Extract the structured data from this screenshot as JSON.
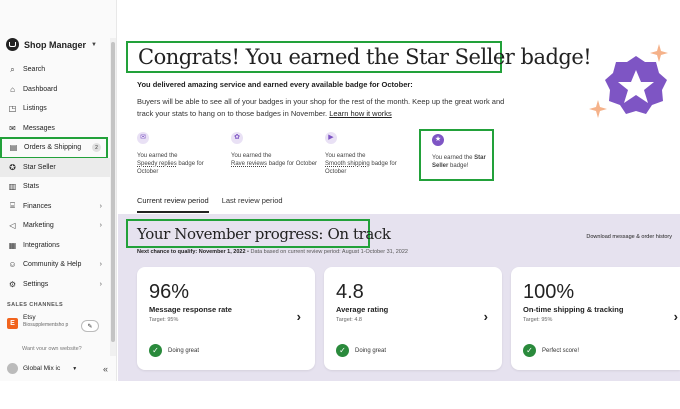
{
  "sidebar": {
    "title": "Shop Manager",
    "items": [
      {
        "label": "Search",
        "icon": "search-icon",
        "glyph": "⌕"
      },
      {
        "label": "Dashboard",
        "icon": "home-icon",
        "glyph": "⌂"
      },
      {
        "label": "Listings",
        "icon": "tag-icon",
        "glyph": "◳"
      },
      {
        "label": "Messages",
        "icon": "envelope-icon",
        "glyph": "✉"
      },
      {
        "label": "Orders & Shipping",
        "icon": "clipboard-icon",
        "glyph": "▤",
        "count": "2"
      },
      {
        "label": "Star Seller",
        "icon": "star-icon",
        "glyph": "✪"
      },
      {
        "label": "Stats",
        "icon": "bar-chart-icon",
        "glyph": "▥"
      },
      {
        "label": "Finances",
        "icon": "bank-icon",
        "glyph": "⌸"
      },
      {
        "label": "Marketing",
        "icon": "megaphone-icon",
        "glyph": "◁"
      },
      {
        "label": "Integrations",
        "icon": "grid-icon",
        "glyph": "▦"
      },
      {
        "label": "Community & Help",
        "icon": "people-icon",
        "glyph": "☺"
      },
      {
        "label": "Settings",
        "icon": "gear-icon",
        "glyph": "⚙"
      }
    ],
    "sales_channels_title": "SALES CHANNELS",
    "etsy": {
      "logo": "E",
      "name": "Etsy",
      "shop": "Biosupplementsho p",
      "edit_glyph": "✎"
    },
    "want_site": "Want your own website?",
    "footer": {
      "account": "Global Mix ic",
      "collapse_glyph": "«"
    }
  },
  "header": {
    "title": "Congrats! You earned the Star Seller badge!",
    "subhead": "You delivered amazing service and earned every available badge for October:",
    "desc": "Buyers will be able to see all of your badges in your shop for the rest of the month. Keep up the great work and track your stats to hang on to those badges in November.",
    "learn_link": "Learn how it works"
  },
  "badges": [
    {
      "pre": "You earned the",
      "name": "Speedy replies",
      "post": "badge for October",
      "icon": "message-badge-icon",
      "glyph": "✉"
    },
    {
      "pre": "You earned the",
      "name": "Rave reviews",
      "post": "badge for October",
      "icon": "review-badge-icon",
      "glyph": "✿"
    },
    {
      "pre": "You earned the",
      "name": "Smooth shipping",
      "post": "badge for October",
      "icon": "truck-badge-icon",
      "glyph": "▶"
    },
    {
      "pre": "You earned the",
      "name": "Star Seller",
      "post": "badge!",
      "icon": "star-badge-icon",
      "glyph": "★"
    }
  ],
  "tabs": [
    {
      "label": "Current review period"
    },
    {
      "label": "Last review period"
    }
  ],
  "progress": {
    "title": "Your November progress: On track",
    "download": "Download message & order history",
    "qualify_label": "Next chance to qualify: November 1, 2022",
    "period": "Data based on current review period: August 1-October 31, 2022",
    "cards": [
      {
        "value": "96%",
        "label": "Message response rate",
        "target": "Target: 95%",
        "status": "Doing great"
      },
      {
        "value": "4.8",
        "label": "Average rating",
        "target": "Target: 4.8",
        "status": "Doing great"
      },
      {
        "value": "100%",
        "label": "On-time shipping & tracking",
        "target": "Target: 95%",
        "status": "Perfect score!"
      }
    ]
  },
  "colors": {
    "highlight_box": "#22a13a",
    "brand_purple": "#7e55c4",
    "progress_bg": "#e6e2ef",
    "etsy_orange": "#f1641e"
  }
}
